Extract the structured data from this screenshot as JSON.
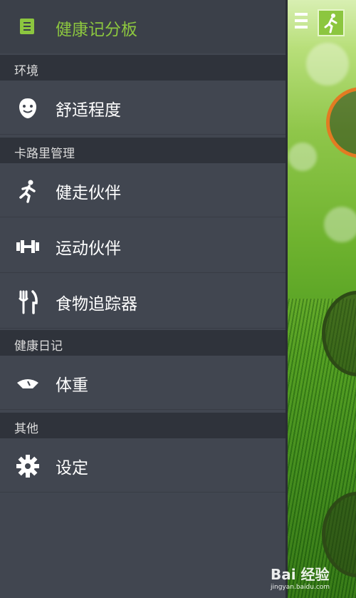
{
  "drawer": {
    "header": {
      "label": "健康记分板",
      "icon": "scoreboard-icon"
    },
    "sections": [
      {
        "title": "环境",
        "items": [
          {
            "label": "舒适程度",
            "icon": "smiley-face-icon"
          }
        ]
      },
      {
        "title": "卡路里管理",
        "items": [
          {
            "label": "健走伙伴",
            "icon": "walking-person-icon"
          },
          {
            "label": "运动伙伴",
            "icon": "dumbbell-icon"
          },
          {
            "label": "食物追踪器",
            "icon": "fork-knife-icon"
          }
        ]
      },
      {
        "title": "健康日记",
        "items": [
          {
            "label": "体重",
            "icon": "scale-icon"
          }
        ]
      },
      {
        "title": "其他",
        "items": [
          {
            "label": "设定",
            "icon": "gear-icon"
          }
        ]
      }
    ]
  },
  "watermark": {
    "text": "Bai 经验",
    "sub": "jingyan.baidu.com"
  },
  "colors": {
    "accent": "#8cc63f",
    "drawer_bg": "#414650",
    "section_bg": "#2f333b"
  }
}
